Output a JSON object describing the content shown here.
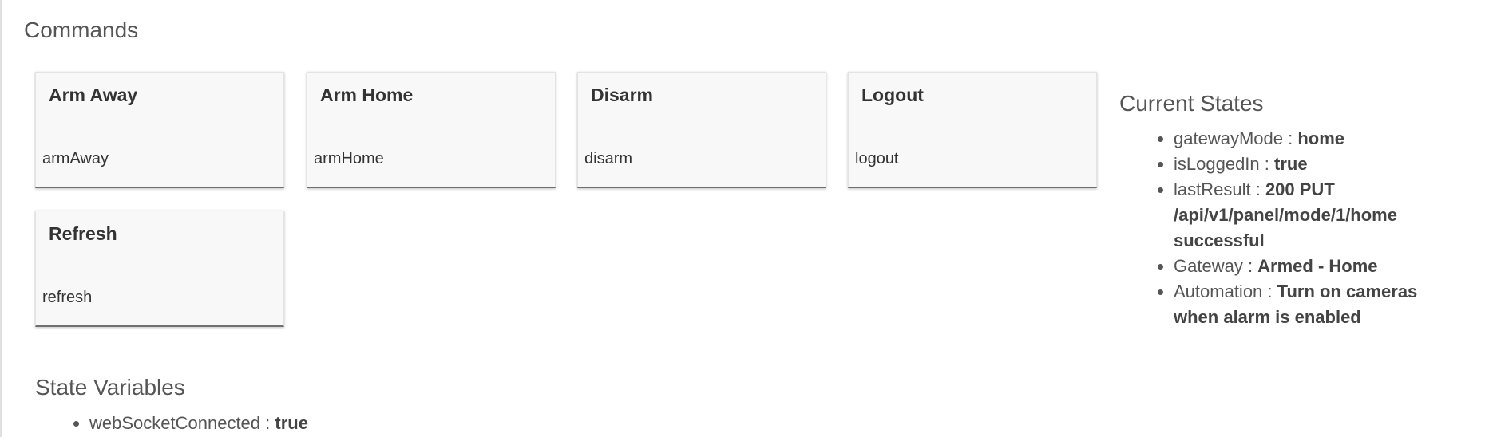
{
  "commands": {
    "title": "Commands",
    "items": [
      {
        "name": "Arm Away",
        "method": "armAway"
      },
      {
        "name": "Arm Home",
        "method": "armHome"
      },
      {
        "name": "Disarm",
        "method": "disarm"
      },
      {
        "name": "Logout",
        "method": "logout"
      },
      {
        "name": "Refresh",
        "method": "refresh"
      }
    ]
  },
  "current_states": {
    "title": "Current States",
    "separator": " : ",
    "items": [
      {
        "key": "gatewayMode",
        "value": "home"
      },
      {
        "key": "isLoggedIn",
        "value": "true"
      },
      {
        "key": "lastResult",
        "value": "200 PUT /api/v1/panel/mode/1/home successful"
      },
      {
        "key": "Gateway",
        "value": "Armed - Home"
      },
      {
        "key": "Automation",
        "value": "Turn on cameras when alarm is enabled"
      }
    ]
  },
  "state_variables": {
    "title": "State Variables",
    "separator": " : ",
    "items": [
      {
        "key": "webSocketConnected",
        "value": "true"
      }
    ]
  }
}
